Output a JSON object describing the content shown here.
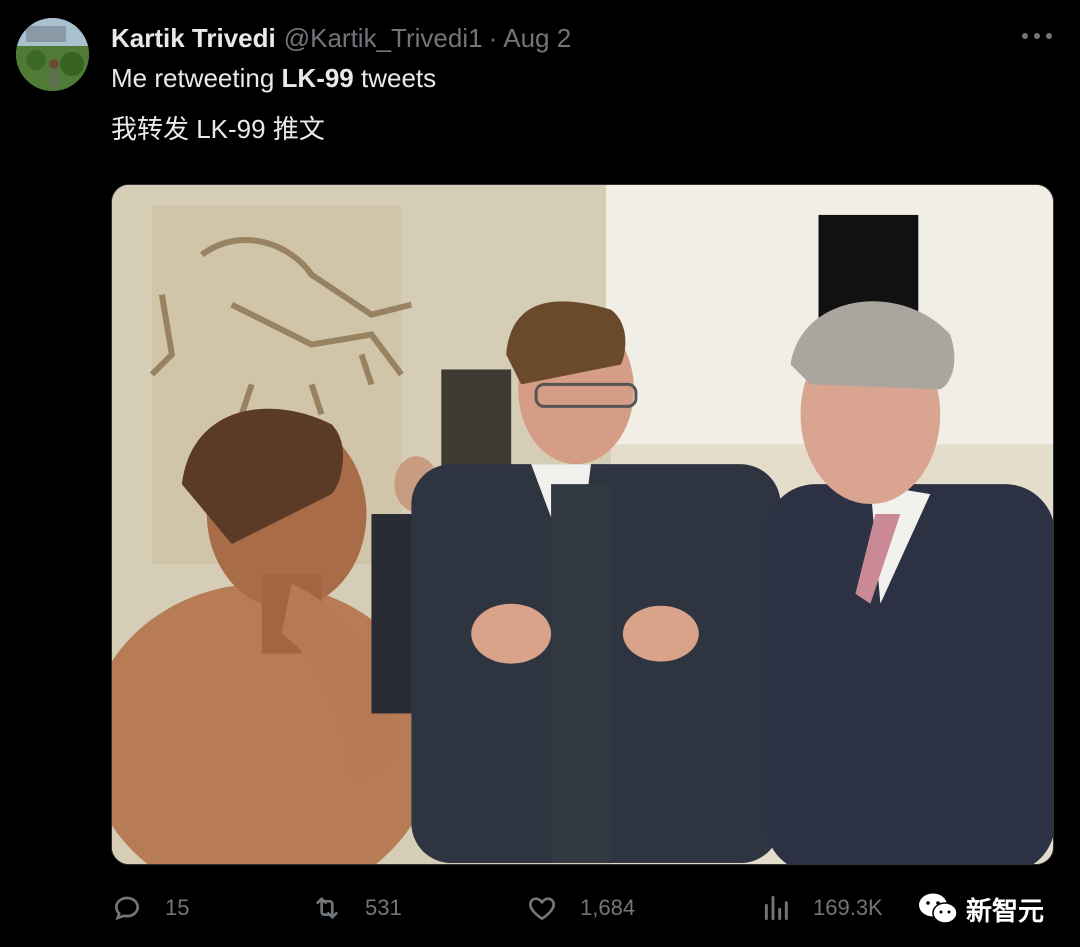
{
  "tweet": {
    "author": "Kartik Trivedi",
    "handle": "@Kartik_Trivedi1",
    "separator": "·",
    "date": "Aug 2",
    "text_prefix": "Me retweeting ",
    "text_bold": "LK-99",
    "text_suffix": " tweets",
    "translation": "我转发 LK-99 推文"
  },
  "actions": {
    "replies": "15",
    "retweets": "531",
    "likes": "1,684",
    "views": "169.3K"
  },
  "watermark": {
    "label": "新智元"
  },
  "colors": {
    "background": "#000000",
    "text_primary": "#e7e9ea",
    "text_secondary": "#71767b"
  },
  "icons": {
    "more": "more-icon",
    "reply": "reply-icon",
    "retweet": "retweet-icon",
    "like": "heart-icon",
    "views": "views-icon",
    "watermark": "wechat-icon"
  }
}
